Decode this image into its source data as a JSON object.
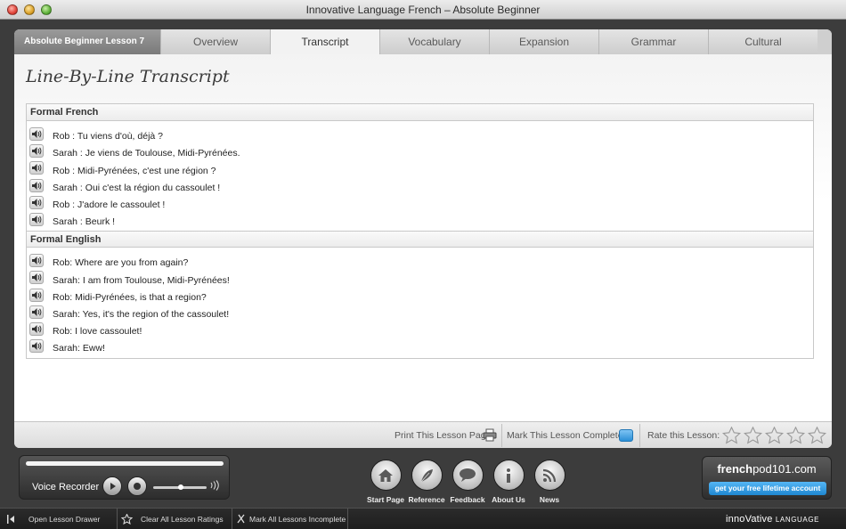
{
  "window": {
    "title": "Innovative Language French – Absolute Beginner"
  },
  "tabs": {
    "lesson_label": "Absolute Beginner Lesson 7",
    "items": [
      "Overview",
      "Transcript",
      "Vocabulary",
      "Expansion",
      "Grammar",
      "Cultural"
    ],
    "active": "Transcript"
  },
  "content": {
    "title": "Line-By-Line Transcript",
    "sections": [
      {
        "heading": "Formal French",
        "lines": [
          "Rob : Tu viens d'où, déjà ?",
          "Sarah : Je viens de Toulouse, Midi-Pyrénées.",
          "Rob : Midi-Pyrénées, c'est une région ?",
          "Sarah : Oui c'est la région du cassoulet !",
          "Rob : J'adore le cassoulet !",
          "Sarah : Beurk !"
        ]
      },
      {
        "heading": "Formal English",
        "lines": [
          "Rob: Where are you from again?",
          "Sarah: I am from Toulouse, Midi-Pyrénées!",
          "Rob: Midi-Pyrénées, is that a region?",
          "Sarah: Yes, it's the region of the cassoulet!",
          "Rob: I love cassoulet!",
          "Sarah: Eww!"
        ]
      }
    ]
  },
  "actionbar": {
    "print_label": "Print This Lesson Page",
    "complete_label": "Mark This Lesson Complete",
    "rate_label": "Rate this Lesson:",
    "rating_max": 5,
    "rating_value": 0
  },
  "recorder": {
    "label": "Voice Recorder"
  },
  "nav": {
    "items": [
      {
        "label": "Start Page",
        "icon": "home-icon"
      },
      {
        "label": "Reference",
        "icon": "feather-icon"
      },
      {
        "label": "Feedback",
        "icon": "speech-bubble-icon"
      },
      {
        "label": "About Us",
        "icon": "info-icon"
      },
      {
        "label": "News",
        "icon": "rss-icon"
      }
    ]
  },
  "promo": {
    "brand_bold": "french",
    "brand_rest": "pod101.com",
    "button": "get your free lifetime account"
  },
  "statusbar": {
    "open_drawer": "Open Lesson Drawer",
    "clear_ratings": "Clear All Lesson Ratings",
    "mark_incomplete": "Mark All Lessons Incomplete",
    "brand_main": "innoVative",
    "brand_sub": "LANGUAGE"
  },
  "colors": {
    "accent_blue": "#2a8fd6",
    "frame": "#3c3c3c",
    "panel": "#f2f2f2"
  }
}
